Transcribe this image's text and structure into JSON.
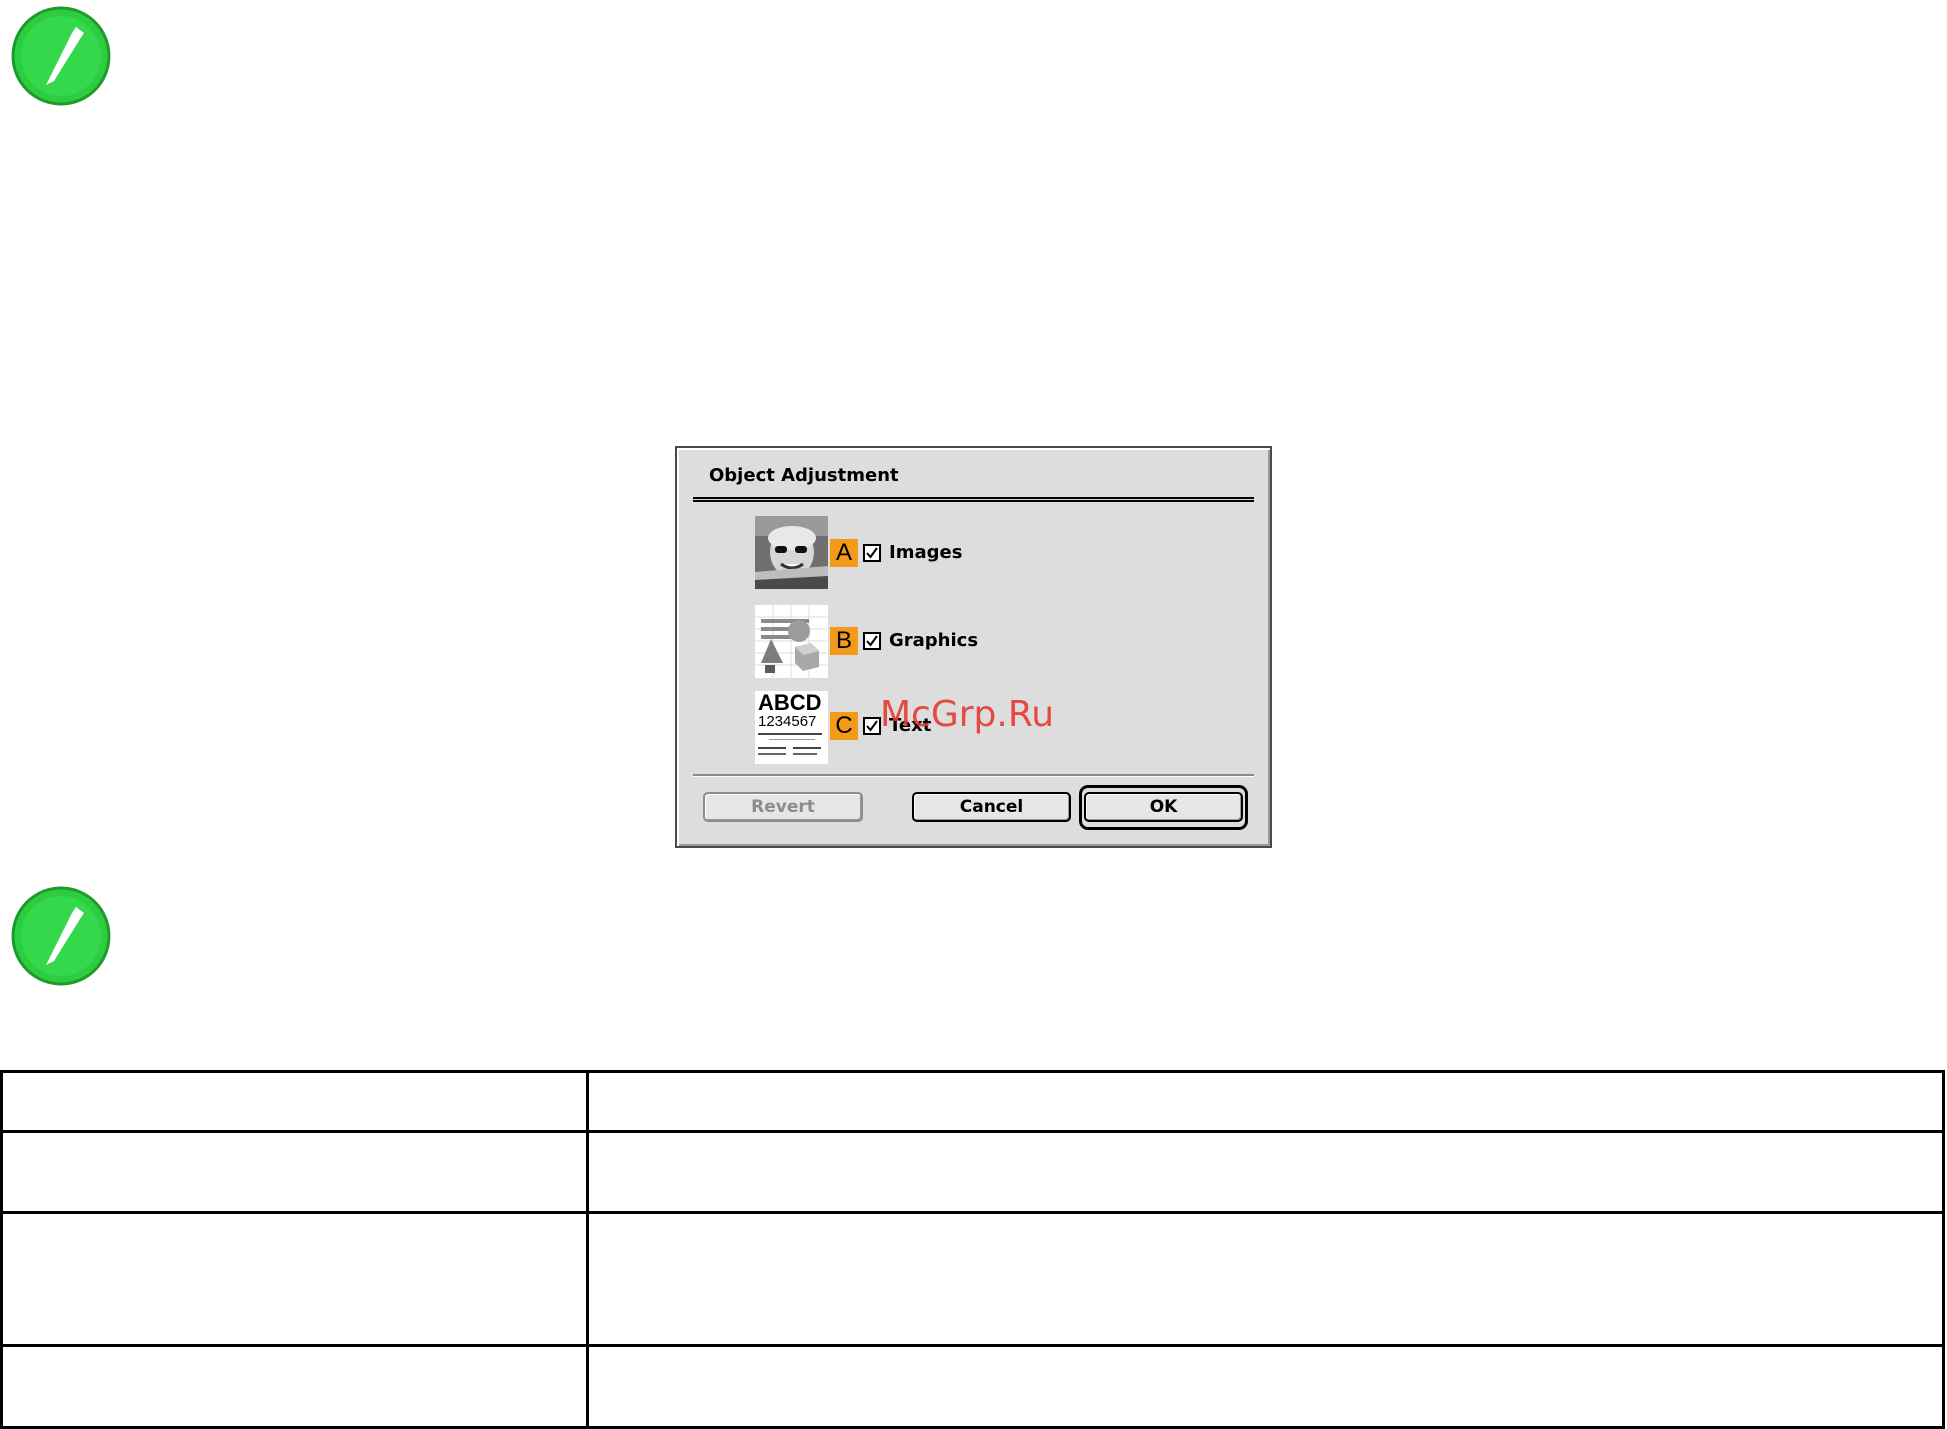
{
  "dialog": {
    "title": "Object Adjustment",
    "options": [
      {
        "badge": "A",
        "label": "Images",
        "checked": true,
        "thumbnail": "portrait-photo"
      },
      {
        "badge": "B",
        "label": "Graphics",
        "checked": true,
        "thumbnail": "3d-shapes-chart"
      },
      {
        "badge": "C",
        "label": "Text",
        "checked": true,
        "thumbnail": "text-sample",
        "thumbnail_text": {
          "line1": "ABCD",
          "line2": "1234567"
        }
      }
    ],
    "buttons": {
      "revert": "Revert",
      "cancel": "Cancel",
      "ok": "OK"
    }
  },
  "watermark": "McGrp.Ru",
  "icons": [
    "note-pencil-icon",
    "note-pencil-icon"
  ],
  "colors": {
    "badge": "#f39a19",
    "note_icon": "#2ecc40",
    "dialog_bg": "#dddddd"
  }
}
